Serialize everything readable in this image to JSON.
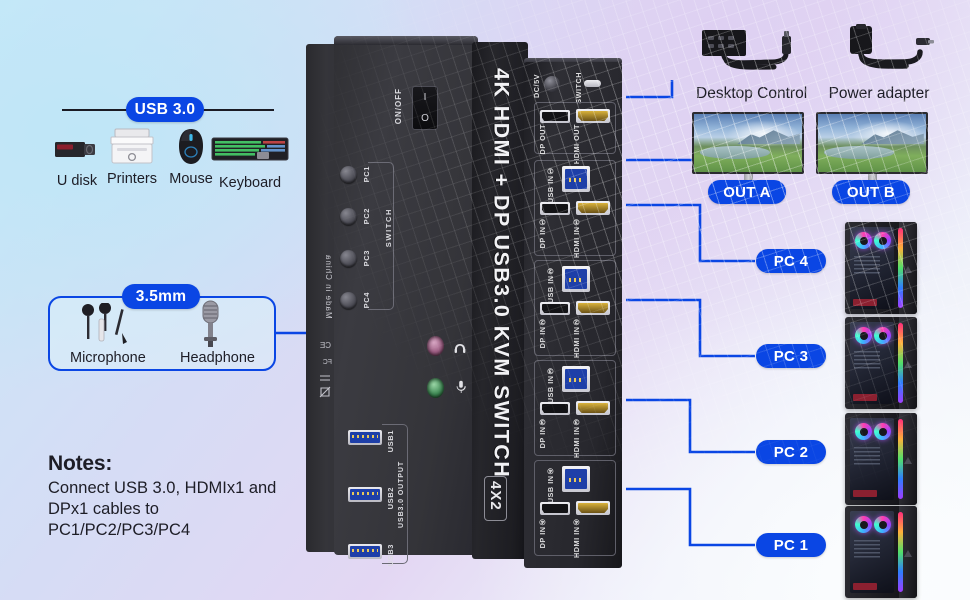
{
  "background": {
    "left_color": "#c7e9f8",
    "mid_color": "#ded0f2",
    "right_color": "#f7fafc"
  },
  "accent": {
    "blue": "#0a46e4",
    "dark": "#1d1d26"
  },
  "usb_group": {
    "badge": "USB 3.0",
    "devices": [
      {
        "name": "U disk",
        "icon": "usb-flash-drive-icon"
      },
      {
        "name": "Printers",
        "icon": "printer-icon"
      },
      {
        "name": "Mouse",
        "icon": "mouse-icon"
      },
      {
        "name": "Keyboard",
        "icon": "keyboard-icon"
      }
    ]
  },
  "audio_group": {
    "badge": "3.5mm",
    "devices": [
      {
        "name": "Microphone",
        "icon": "earphones-icon"
      },
      {
        "name": "Headphone",
        "icon": "microphone-icon"
      }
    ]
  },
  "notes": {
    "heading": "Notes:",
    "body": "Connect USB 3.0, HDMIx1 and DPx1 cables to PC1/PC2/PC3/PC4"
  },
  "device": {
    "title": "4K HDMI + DP USB3.0 KVM SWITCH",
    "model": "4X2",
    "power_label": "ON/OFF",
    "rocker_on": "I",
    "rocker_off": "O",
    "switch_label": "SWITCH",
    "switch_buttons": [
      "PC1",
      "PC2",
      "PC3",
      "PC4"
    ],
    "usb_output_label": "USB3.0 OUTPUT",
    "usb_ports": [
      "USB1",
      "USB2",
      "USB3"
    ],
    "audio_jacks": [
      {
        "label": "headphone-jack",
        "color": "#b87fa4",
        "icon": "headphone-icon"
      },
      {
        "label": "microphone-jack",
        "color": "#5aa06c",
        "icon": "microphone-icon"
      }
    ],
    "certs": [
      "Made in China",
      "FCC",
      "CE",
      "RoHS",
      "WEEE"
    ],
    "rear": {
      "dc_label": "DC/5V",
      "switch_label": "SWITCH",
      "out_group": [
        "DP OUT",
        "HDMI OUT"
      ],
      "in_groups": [
        {
          "usb": "USB IN①",
          "dp": "DP IN①",
          "hdmi": "HDMI IN①"
        },
        {
          "usb": "USB IN②",
          "dp": "DP IN②",
          "hdmi": "HDMI IN②"
        },
        {
          "usb": "USB IN③",
          "dp": "DP IN③",
          "hdmi": "HDMI IN③"
        },
        {
          "usb": "USB IN④",
          "dp": "DP IN④",
          "hdmi": "HDMI IN④"
        }
      ]
    }
  },
  "accessories": [
    {
      "name": "Desktop Control",
      "icon": "desktop-control-icon"
    },
    {
      "name": "Power adapter",
      "icon": "power-adapter-icon"
    }
  ],
  "outputs": [
    {
      "badge": "OUT A",
      "icon": "monitor-icon"
    },
    {
      "badge": "OUT B",
      "icon": "monitor-icon"
    }
  ],
  "computers": [
    {
      "badge": "PC 4",
      "icon": "pc-tower-icon"
    },
    {
      "badge": "PC 3",
      "icon": "pc-tower-icon"
    },
    {
      "badge": "PC 2",
      "icon": "pc-tower-icon"
    },
    {
      "badge": "PC 1",
      "icon": "pc-tower-icon"
    }
  ]
}
